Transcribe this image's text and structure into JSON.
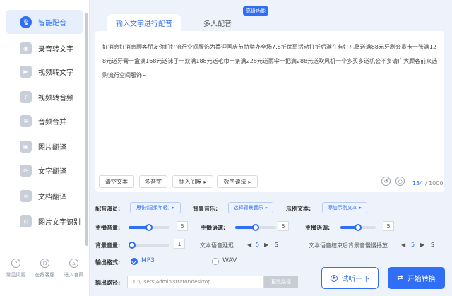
{
  "sidebar": {
    "items": [
      {
        "label": "智能配音",
        "icon": "microphone-icon",
        "active": true
      },
      {
        "label": "录音转文字",
        "icon": "recording-icon"
      },
      {
        "label": "视频转文字",
        "icon": "video-text-icon"
      },
      {
        "label": "视频转音频",
        "icon": "video-audio-icon"
      },
      {
        "label": "音频合并",
        "icon": "audio-merge-icon"
      },
      {
        "label": "图片翻译",
        "icon": "image-translate-icon"
      },
      {
        "label": "文字翻译",
        "icon": "text-translate-icon"
      },
      {
        "label": "文档翻译",
        "icon": "document-translate-icon"
      },
      {
        "label": "图片文字识别",
        "icon": "ocr-icon"
      }
    ],
    "bottom": [
      {
        "label": "常见问题",
        "icon": "question-icon"
      },
      {
        "label": "在线客服",
        "icon": "headset-icon"
      },
      {
        "label": "进入官网",
        "icon": "home-icon"
      }
    ]
  },
  "tabs": {
    "tab1": "输入文字进行配音",
    "tab2": "多人配音",
    "badge": "高级功能"
  },
  "editor": {
    "text": "好消息好消息顾客朋友你们好流行空间服饰为喜迎国庆节特举办全场7.8折优惠活动打折后满在有好礼赠送满88元牙刷会员卡一张满128元送牙膏一盒满168元送袜子一双满188元送毛巾一条满228元送雨伞一把满288元送吹风机一个多买多送机会不多请广大顾客前来选购流行空间服饰~",
    "buttons": {
      "clear": "清空文本",
      "polyphone": "多音字",
      "pause": "插入间隔",
      "number": "数字读法"
    },
    "count": "134",
    "max": "/ 1000"
  },
  "settings": {
    "voice_label": "配音演员:",
    "voice_value": "思悦(温柔年轻)",
    "bgm_label": "背景音乐:",
    "bgm_value": "选择背景音乐",
    "sample_label": "示例文本:",
    "sample_value": "添加示例文本",
    "volume_label": "主播音量:",
    "volume_value": "5",
    "volume_level": 0.5,
    "speed_label": "主播语速:",
    "speed_value": "5",
    "speed_level": 0.5,
    "pitch_label": "主播语调:",
    "pitch_value": "5",
    "pitch_level": 0.5,
    "bg_volume_label": "背景音量:",
    "bg_volume_value": "1",
    "bg_volume_level": 0.0,
    "delay_label": "文本语音延迟",
    "delay_value": "5",
    "delay_unit": "S",
    "fade_label": "文本语音结束后背景音慢慢播放",
    "fade_value": "5",
    "fade_unit": "S"
  },
  "output": {
    "format_label": "输出格式:",
    "format_mp3": "MP3",
    "format_wav": "WAV",
    "path_label": "输出路径:",
    "path_value": "C:\\Users\\Administrator\\desktop",
    "path_button": "更改路径"
  },
  "actions": {
    "listen": "试听一下",
    "convert": "开始转换"
  },
  "colors": {
    "accent": "#2f6ef5"
  }
}
